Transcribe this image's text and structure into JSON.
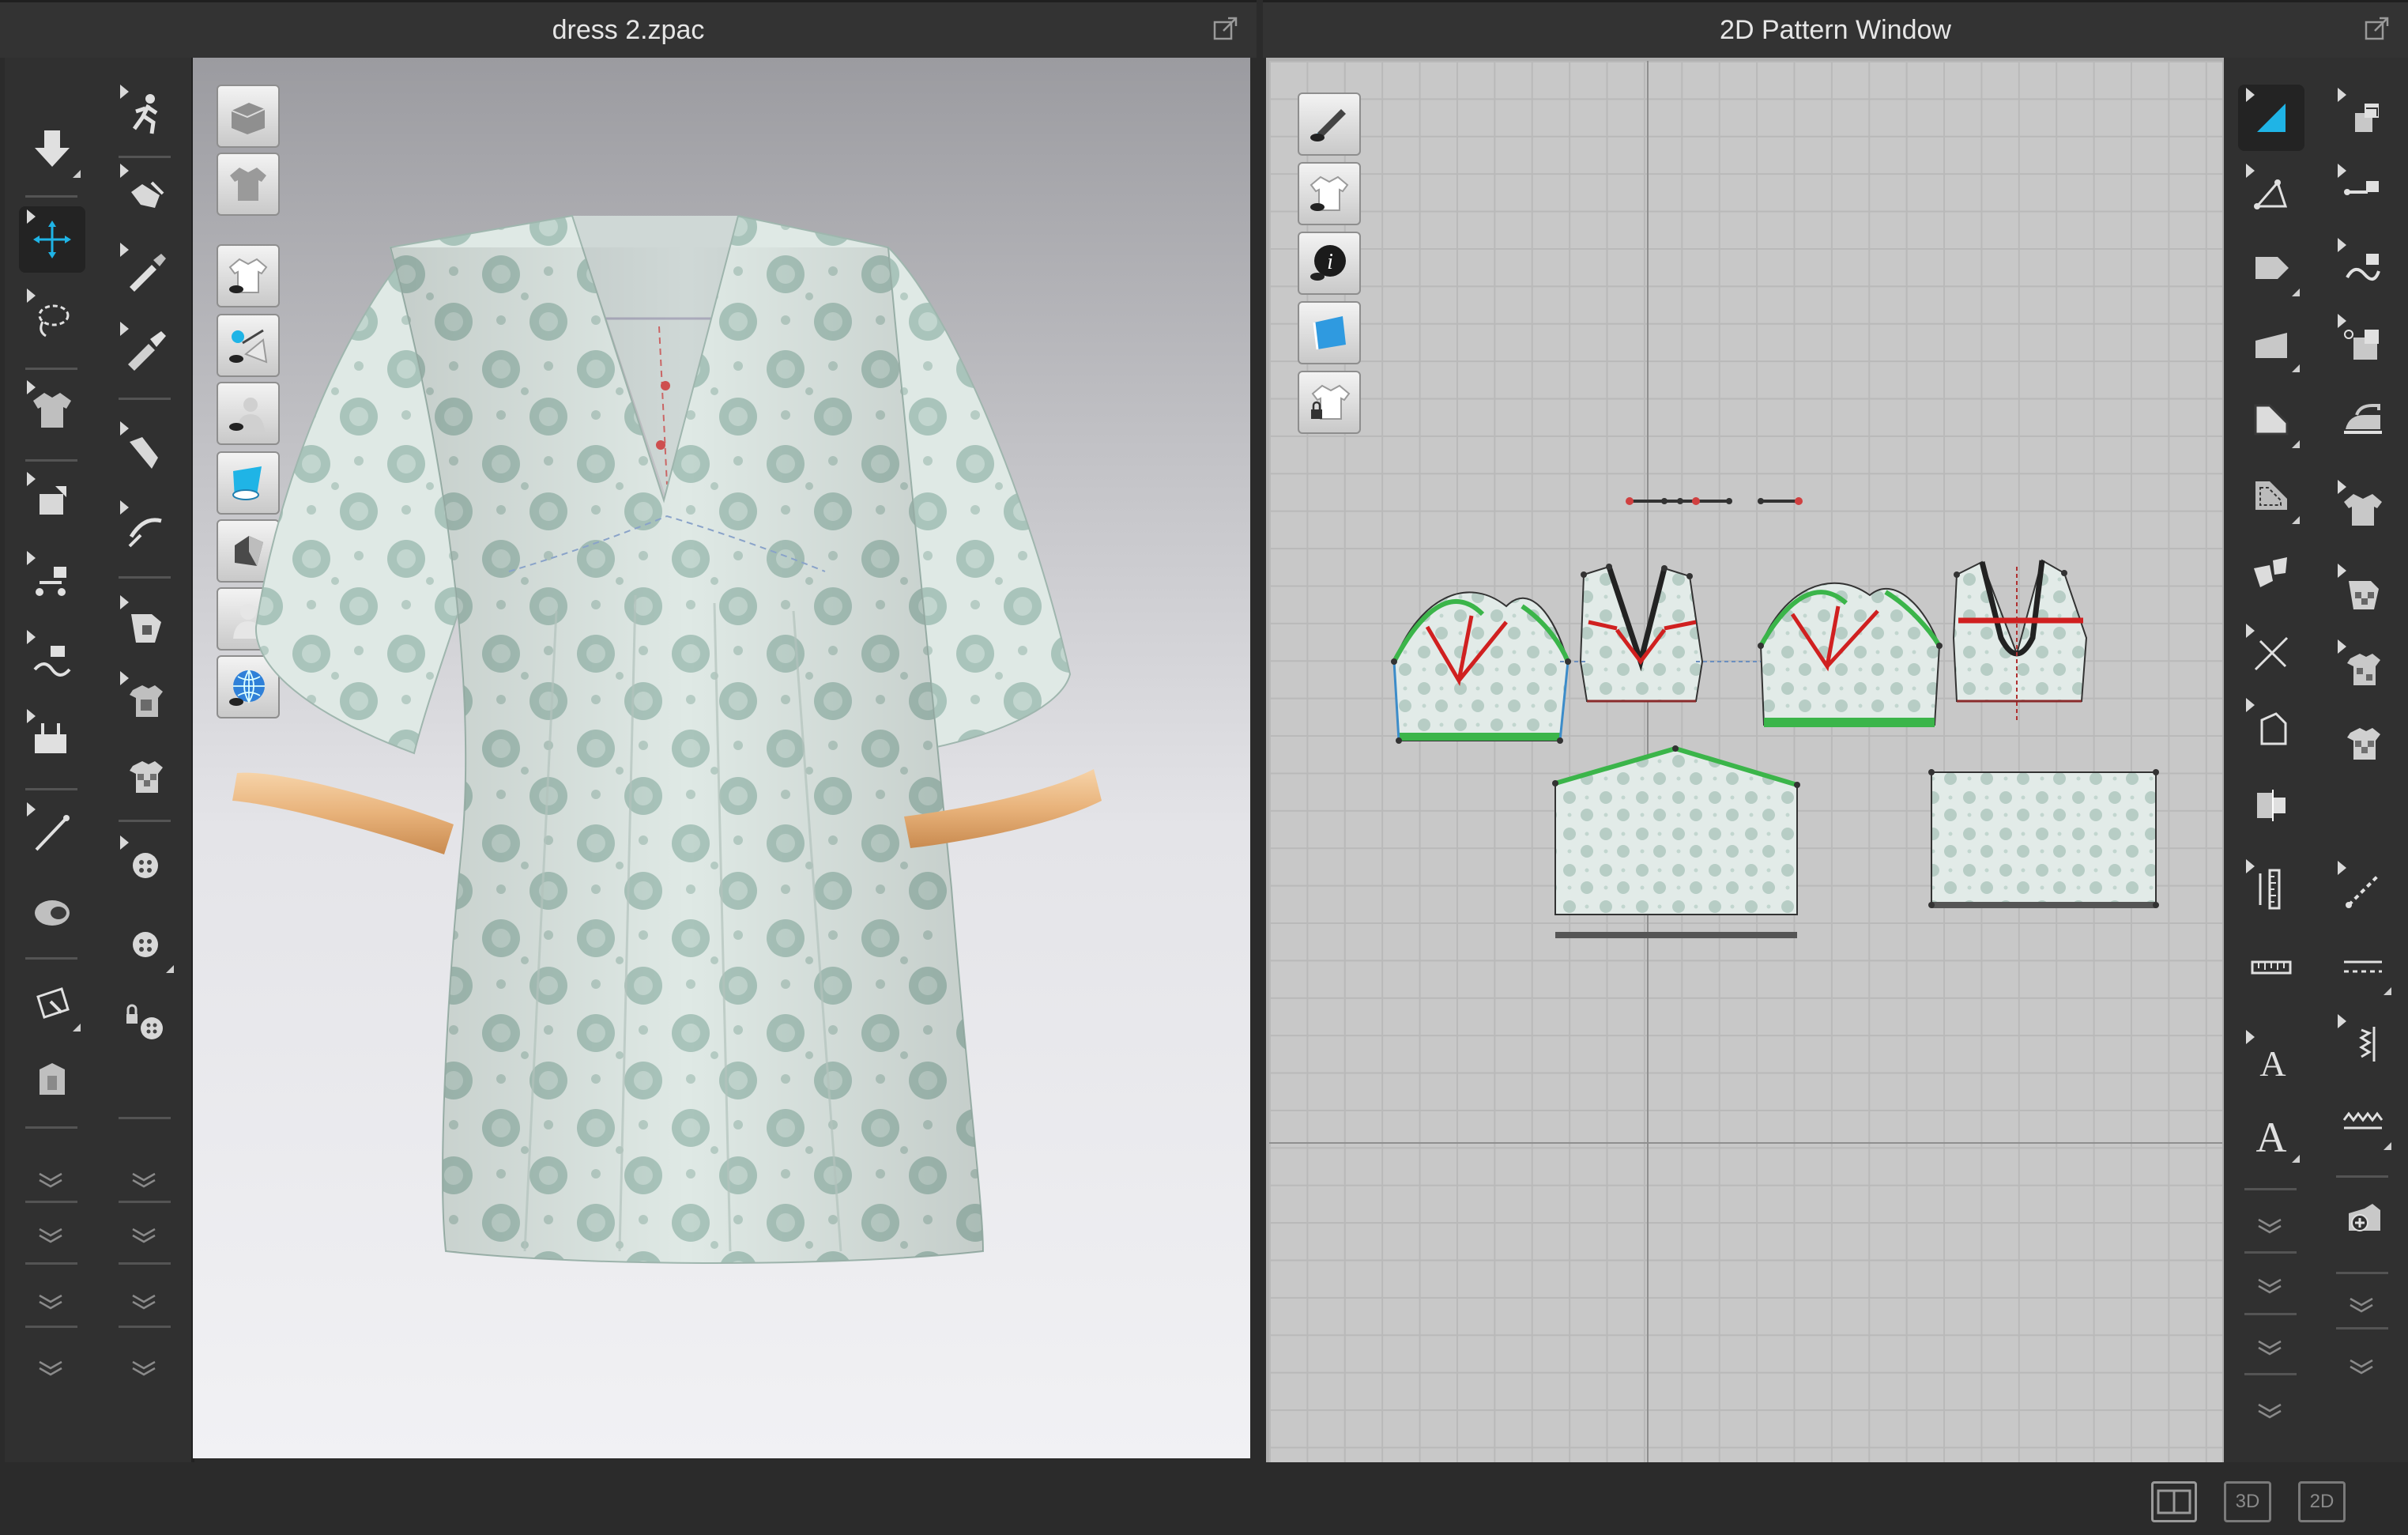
{
  "window_3d": {
    "title": "dress 2.zpac"
  },
  "window_2d": {
    "title": "2D Pattern Window"
  },
  "bottom_bar": {
    "view_3d": "3D",
    "view_2d": "2D"
  },
  "left_toolbar_col1": [
    "arrow-down-icon",
    "move-gizmo-icon",
    "lasso-select-icon",
    "garment-icon",
    "fold-arrange-icon",
    "segment-move-icon",
    "tack-icon",
    "pin-icon",
    "line-icon",
    "texture-icon",
    "transform-icon",
    "avatar-icon"
  ],
  "left_toolbar_col2": [
    "walk-pose-icon",
    "sewing-tool-icon",
    "pen-tool-icon",
    "brush-tool-icon",
    "edit-curve-icon",
    "edit-curve-2-icon",
    "graphic-icon",
    "fabric-icon",
    "checker-icon",
    "button-icon",
    "button-2-icon",
    "lock-button-icon"
  ],
  "view3d_tools": [
    "avatar-display-icon",
    "garment-display-icon",
    "show-garment-icon",
    "show-pin-icon",
    "show-avatar-icon",
    "surface-icon",
    "shading-icon",
    "avatar-silhouette-icon",
    "globe-icon"
  ],
  "view2d_tools": [
    "show-pen-icon",
    "show-garment-2d-icon",
    "info-icon",
    "show-fabric-icon",
    "lock-garment-icon"
  ],
  "right_toolbar_col1": [
    "select-mesh-icon",
    "polygon-point-icon",
    "rectangle-icon",
    "polygon-icon",
    "internal-shape-icon",
    "dashed-rect-icon",
    "pocket-icon",
    "cut-line-icon",
    "internal-polygon-icon",
    "fold-icon",
    "ruler-icon",
    "measure-icon",
    "text-icon",
    "text-2-icon"
  ],
  "right_toolbar_col2": [
    "sew-icon",
    "segment-sew-icon",
    "free-sew-icon",
    "tack-on-avatar-icon",
    "iron-icon",
    "shirt-icon",
    "fabric-pattern-icon",
    "trim-icon",
    "checker-shirt-icon",
    "dashed-line-icon",
    "stitch-icon",
    "zigzag-icon",
    "wave-icon",
    "add-graphic-icon"
  ],
  "colors": {
    "panel_bg": "#303030",
    "accent": "#1fb4e6",
    "seam_green": "#3bb54a",
    "seam_red": "#d02020",
    "cuff": "#e8b27a",
    "fabric": "#dfe9e5"
  }
}
